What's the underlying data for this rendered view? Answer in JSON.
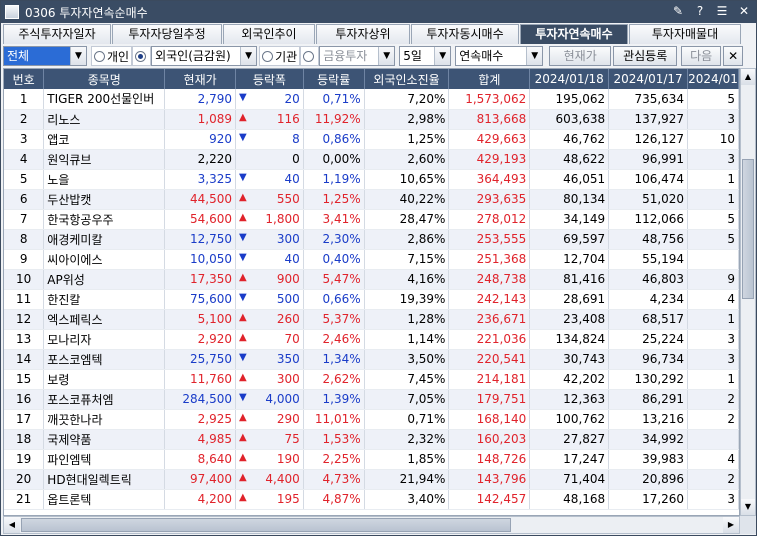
{
  "window": {
    "title": "0306 투자자연속순매수"
  },
  "tabs": [
    {
      "label": "주식투자자일자",
      "active": false
    },
    {
      "label": "투자자당일추정",
      "active": false
    },
    {
      "label": "외국인추이",
      "active": false
    },
    {
      "label": "투자자상위",
      "active": false
    },
    {
      "label": "투자자동시매수",
      "active": false
    },
    {
      "label": "투자자연속매수",
      "active": true
    },
    {
      "label": "투자자매물대",
      "active": false
    }
  ],
  "toolbar": {
    "market": "전체",
    "investor_individual": "개인",
    "investor_foreign": "외국인(금감원)",
    "investor_institution": "기관",
    "institution_type": "금융투자",
    "period": "5일",
    "mode": "연속매수",
    "price_button": "현재가",
    "watch_button": "관심등록",
    "next_button": "다음"
  },
  "columns": [
    "번호",
    "종목명",
    "현재가",
    "등락폭",
    "등락률",
    "외국인소진율",
    "합계",
    "2024/01/18",
    "2024/01/17",
    "2024/01"
  ],
  "rows": [
    {
      "no": "1",
      "name": "TIGER 200선물인버",
      "price": "2,790",
      "dir": "down",
      "change": "20",
      "rate": "0,71%",
      "foreign": "7,20%",
      "total": "1,573,062",
      "d1": "195,062",
      "d2": "735,634",
      "d3": "5"
    },
    {
      "no": "2",
      "name": "리노스",
      "price": "1,089",
      "dir": "up",
      "change": "116",
      "rate": "11,92%",
      "foreign": "2,98%",
      "total": "813,668",
      "d1": "603,638",
      "d2": "137,927",
      "d3": "3"
    },
    {
      "no": "3",
      "name": "앱코",
      "price": "920",
      "dir": "down",
      "change": "8",
      "rate": "0,86%",
      "foreign": "1,25%",
      "total": "429,663",
      "d1": "46,762",
      "d2": "126,127",
      "d3": "10"
    },
    {
      "no": "4",
      "name": "원익큐브",
      "price": "2,220",
      "dir": "flat",
      "change": "0",
      "rate": "0,00%",
      "foreign": "2,60%",
      "total": "429,193",
      "d1": "48,622",
      "d2": "96,991",
      "d3": "3"
    },
    {
      "no": "5",
      "name": "노을",
      "price": "3,325",
      "dir": "down",
      "change": "40",
      "rate": "1,19%",
      "foreign": "10,65%",
      "total": "364,493",
      "d1": "46,051",
      "d2": "106,474",
      "d3": "1"
    },
    {
      "no": "6",
      "name": "두산밥캣",
      "price": "44,500",
      "dir": "up",
      "change": "550",
      "rate": "1,25%",
      "foreign": "40,22%",
      "total": "293,635",
      "d1": "80,134",
      "d2": "51,020",
      "d3": "1"
    },
    {
      "no": "7",
      "name": "한국항공우주",
      "price": "54,600",
      "dir": "up",
      "change": "1,800",
      "rate": "3,41%",
      "foreign": "28,47%",
      "total": "278,012",
      "d1": "34,149",
      "d2": "112,066",
      "d3": "5"
    },
    {
      "no": "8",
      "name": "애경케미칼",
      "price": "12,750",
      "dir": "down",
      "change": "300",
      "rate": "2,30%",
      "foreign": "2,86%",
      "total": "253,555",
      "d1": "69,597",
      "d2": "48,756",
      "d3": "5"
    },
    {
      "no": "9",
      "name": "씨아이에스",
      "price": "10,050",
      "dir": "down",
      "change": "40",
      "rate": "0,40%",
      "foreign": "7,15%",
      "total": "251,368",
      "d1": "12,704",
      "d2": "55,194",
      "d3": ""
    },
    {
      "no": "10",
      "name": "AP위성",
      "price": "17,350",
      "dir": "up",
      "change": "900",
      "rate": "5,47%",
      "foreign": "4,16%",
      "total": "248,738",
      "d1": "81,416",
      "d2": "46,803",
      "d3": "9"
    },
    {
      "no": "11",
      "name": "한진칼",
      "price": "75,600",
      "dir": "down",
      "change": "500",
      "rate": "0,66%",
      "foreign": "19,39%",
      "total": "242,143",
      "d1": "28,691",
      "d2": "4,234",
      "d3": "4"
    },
    {
      "no": "12",
      "name": "엑스페릭스",
      "price": "5,100",
      "dir": "up",
      "change": "260",
      "rate": "5,37%",
      "foreign": "1,28%",
      "total": "236,671",
      "d1": "23,408",
      "d2": "68,517",
      "d3": "1"
    },
    {
      "no": "13",
      "name": "모나리자",
      "price": "2,920",
      "dir": "up",
      "change": "70",
      "rate": "2,46%",
      "foreign": "1,14%",
      "total": "221,036",
      "d1": "134,824",
      "d2": "25,224",
      "d3": "3"
    },
    {
      "no": "14",
      "name": "포스코엠텍",
      "price": "25,750",
      "dir": "down",
      "change": "350",
      "rate": "1,34%",
      "foreign": "3,50%",
      "total": "220,541",
      "d1": "30,743",
      "d2": "96,734",
      "d3": "3"
    },
    {
      "no": "15",
      "name": "보령",
      "price": "11,760",
      "dir": "up",
      "change": "300",
      "rate": "2,62%",
      "foreign": "7,45%",
      "total": "214,181",
      "d1": "42,202",
      "d2": "130,292",
      "d3": "1"
    },
    {
      "no": "16",
      "name": "포스코퓨처엠",
      "price": "284,500",
      "dir": "down",
      "change": "4,000",
      "rate": "1,39%",
      "foreign": "7,05%",
      "total": "179,751",
      "d1": "12,363",
      "d2": "86,291",
      "d3": "2"
    },
    {
      "no": "17",
      "name": "깨끗한나라",
      "price": "2,925",
      "dir": "up",
      "change": "290",
      "rate": "11,01%",
      "foreign": "0,71%",
      "total": "168,140",
      "d1": "100,762",
      "d2": "13,216",
      "d3": "2"
    },
    {
      "no": "18",
      "name": "국제약품",
      "price": "4,985",
      "dir": "up",
      "change": "75",
      "rate": "1,53%",
      "foreign": "2,32%",
      "total": "160,203",
      "d1": "27,827",
      "d2": "34,992",
      "d3": ""
    },
    {
      "no": "19",
      "name": "파인엠텍",
      "price": "8,640",
      "dir": "up",
      "change": "190",
      "rate": "2,25%",
      "foreign": "1,85%",
      "total": "148,726",
      "d1": "17,247",
      "d2": "39,983",
      "d3": "4"
    },
    {
      "no": "20",
      "name": "HD현대일렉트릭",
      "price": "97,400",
      "dir": "up",
      "change": "4,400",
      "rate": "4,73%",
      "foreign": "21,94%",
      "total": "143,796",
      "d1": "71,404",
      "d2": "20,896",
      "d3": "2"
    },
    {
      "no": "21",
      "name": "옵트론텍",
      "price": "4,200",
      "dir": "up",
      "change": "195",
      "rate": "4,87%",
      "foreign": "3,40%",
      "total": "142,457",
      "d1": "48,168",
      "d2": "17,260",
      "d3": "3"
    }
  ],
  "colors": {
    "header": "#3d5475",
    "up": "#e0232b",
    "down": "#1a3cc8",
    "active_tab": "#3a4c64"
  }
}
